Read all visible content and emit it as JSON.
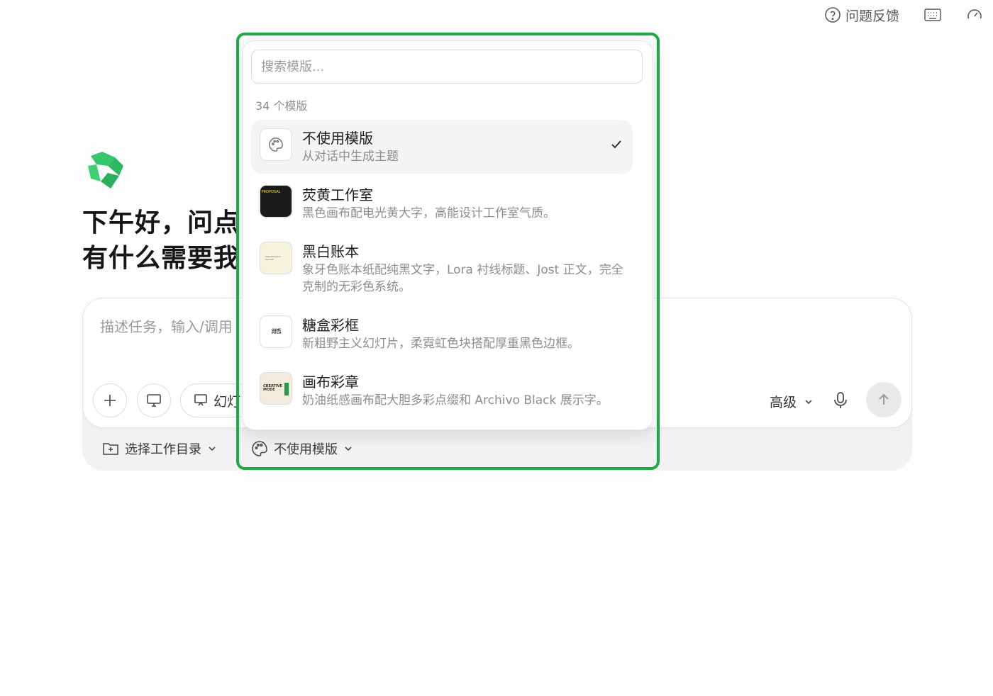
{
  "topbar": {
    "feedback_label": "问题反馈",
    "icons": [
      "help-circle-icon",
      "keyboard-icon",
      "gauge-icon"
    ]
  },
  "brand": {
    "logo": "app-logo",
    "accent": "#2ecc71"
  },
  "greeting": {
    "line1": "下午好，问点",
    "line2": "有什么需要我"
  },
  "composer": {
    "placeholder": "描述任务，输入/调用",
    "slides_label": "幻灯",
    "advanced_label": "高级"
  },
  "bottom": {
    "workdir_label": "选择工作目录",
    "template_label": "不使用模版"
  },
  "dropdown": {
    "search_placeholder": "搜索模版...",
    "count_label": "34 个模版",
    "items": [
      {
        "title": "不使用模版",
        "desc": "从对话中生成主题",
        "selected": true,
        "thumb": "palette-icon"
      },
      {
        "title": "荧黄工作室",
        "desc": "黑色画布配电光黄大字，高能设计工作室气质。",
        "selected": false,
        "thumb_text": "PROPOSAL"
      },
      {
        "title": "黑白账本",
        "desc": "象牙色账本纸配纯黑文字，Lora 衬线标题、Jost 正文，完全克制的无彩色系统。",
        "selected": false,
        "thumb_text": "Case Research Summit"
      },
      {
        "title": "糖盒彩框",
        "desc": "新粗野主义幻灯片，柔霓虹色块搭配厚重黑色边框。",
        "selected": false,
        "thumb_text": "GAME PITCH"
      },
      {
        "title": "画布彩章",
        "desc": "奶油纸感画布配大胆多彩点缀和 Archivo Black 展示字。",
        "selected": false,
        "thumb_text": "CREATIVE MODE"
      }
    ]
  },
  "highlight_color": "#1fa845"
}
